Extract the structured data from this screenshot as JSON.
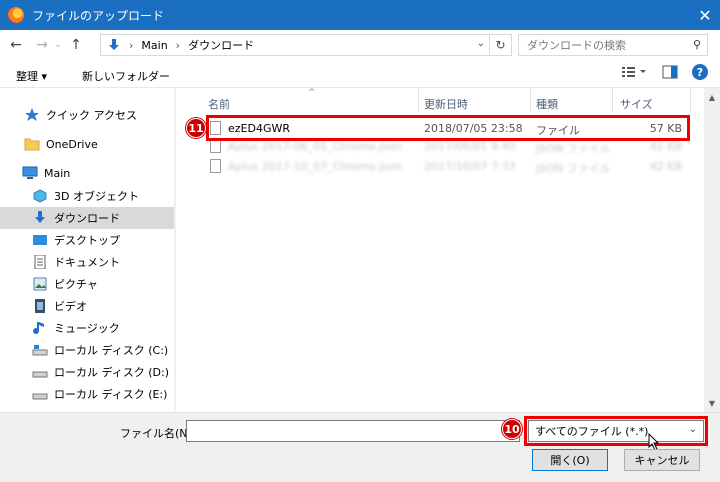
{
  "window": {
    "title": "ファイルのアップロード",
    "close_glyph": "✕"
  },
  "address": {
    "root": "Main",
    "folder": "ダウンロード",
    "separator": "›"
  },
  "search": {
    "placeholder": "ダウンロードの検索"
  },
  "toolbar": {
    "organize": "整理 ▾",
    "new_folder": "新しいフォルダー"
  },
  "nav": {
    "items": [
      {
        "label": "クイック アクセス",
        "icon": "star-icon"
      },
      {
        "label": "OneDrive",
        "icon": "folder-icon"
      },
      {
        "label": "Main",
        "icon": "computer-icon"
      },
      {
        "label": "3D オブジェクト",
        "icon": "cube-icon"
      },
      {
        "label": "ダウンロード",
        "icon": "download-icon"
      },
      {
        "label": "デスクトップ",
        "icon": "desktop-icon"
      },
      {
        "label": "ドキュメント",
        "icon": "document-icon"
      },
      {
        "label": "ピクチャ",
        "icon": "picture-icon"
      },
      {
        "label": "ビデオ",
        "icon": "video-icon"
      },
      {
        "label": "ミュージック",
        "icon": "music-icon"
      },
      {
        "label": "ローカル ディスク (C:)",
        "icon": "disk-icon"
      },
      {
        "label": "ローカル ディスク (D:)",
        "icon": "disk-icon"
      },
      {
        "label": "ローカル ディスク (E:)",
        "icon": "disk-icon"
      }
    ]
  },
  "columns": {
    "name": "名前",
    "date": "更新日時",
    "type": "種類",
    "size": "サイズ"
  },
  "files": [
    {
      "name": "ezED4GWR",
      "date": "2018/07/05 23:58",
      "type": "ファイル",
      "size": "57 KB"
    },
    {
      "name": "Aplus 2017-06_01_Chrome.json",
      "date": "2017/06/01 9:40",
      "type": "JSON ファイル",
      "size": "42 KB"
    },
    {
      "name": "Aplus 2017-10_07_Chrome.json",
      "date": "2017/10/07 7:33",
      "type": "JSON ファイル",
      "size": "42 KB"
    }
  ],
  "callouts": {
    "first": "11",
    "second": "10"
  },
  "bottom": {
    "filename_label": "ファイル名(N):",
    "filename_value": "",
    "filter": "すべてのファイル (*.*)",
    "open_button": "開く(O)",
    "cancel_button": "キャンセル"
  },
  "colors": {
    "titlebar": "#1a6fc1",
    "highlight": "#e00000",
    "callout": "#cc0000"
  }
}
